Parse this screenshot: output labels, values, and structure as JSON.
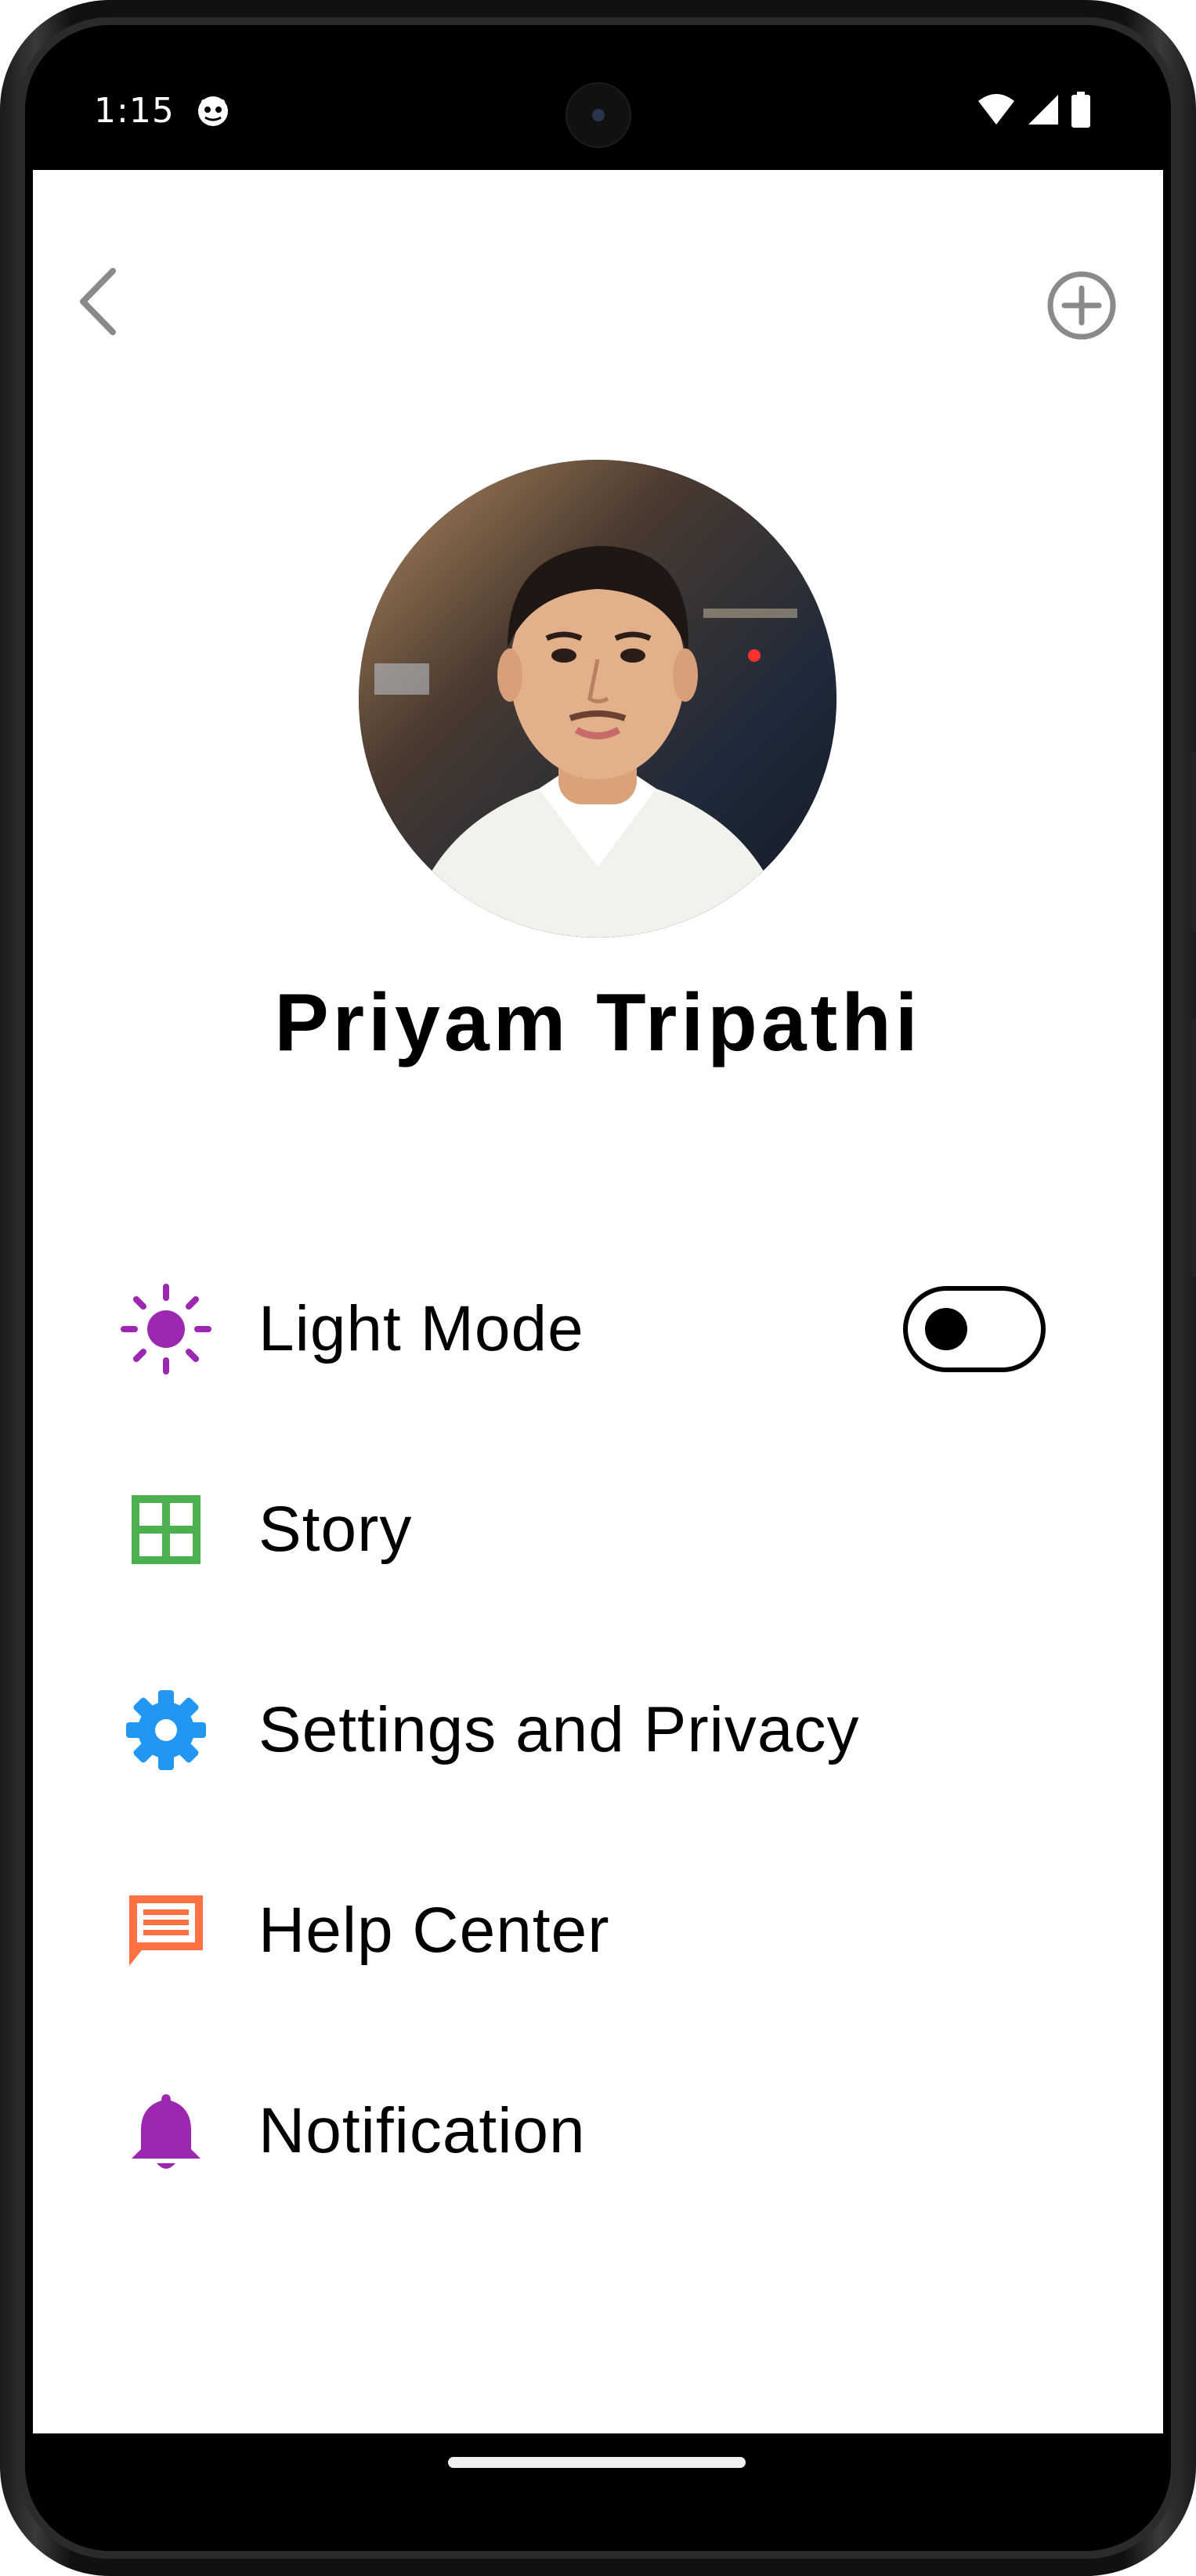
{
  "status_bar": {
    "time": "1:15",
    "app_icon": "android-face-icon",
    "right_icons": [
      "wifi-icon",
      "signal-icon",
      "battery-icon"
    ]
  },
  "header": {
    "back_icon": "chevron-left-icon",
    "add_icon": "add-circle-icon"
  },
  "profile": {
    "name": "Priyam Tripathi",
    "avatar": "profile-photo"
  },
  "menu": {
    "items": [
      {
        "label": "Light Mode",
        "icon": "sun-icon",
        "color": "#9c27b0",
        "toggle": false
      },
      {
        "label": "Story",
        "icon": "grid-icon",
        "color": "#4caf50"
      },
      {
        "label": "Settings and Privacy",
        "icon": "gear-icon",
        "color": "#2196f3"
      },
      {
        "label": "Help Center",
        "icon": "chat-icon",
        "color": "#ff7043"
      },
      {
        "label": "Notification",
        "icon": "bell-icon",
        "color": "#9c27b0"
      }
    ]
  },
  "colors": {
    "background": "#ffffff",
    "text": "#000000",
    "icon_gray": "#8a8a8a"
  }
}
